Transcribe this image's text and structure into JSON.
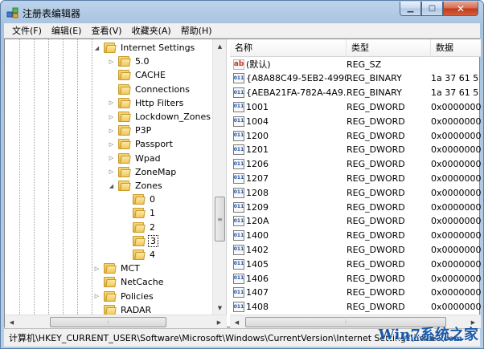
{
  "window": {
    "title": "注册表编辑器"
  },
  "menu": [
    {
      "label": "文件(F)"
    },
    {
      "label": "编辑(E)"
    },
    {
      "label": "查看(V)"
    },
    {
      "label": "收藏夹(A)"
    },
    {
      "label": "帮助(H)"
    }
  ],
  "tree": {
    "items": [
      {
        "label": "Internet Settings",
        "expander": "open",
        "level": 0
      },
      {
        "label": "5.0",
        "expander": "closed",
        "level": 1
      },
      {
        "label": "CACHE",
        "expander": "none",
        "level": 1
      },
      {
        "label": "Connections",
        "expander": "none",
        "level": 1
      },
      {
        "label": "Http Filters",
        "expander": "closed",
        "level": 1
      },
      {
        "label": "Lockdown_Zones",
        "expander": "closed",
        "level": 1
      },
      {
        "label": "P3P",
        "expander": "closed",
        "level": 1
      },
      {
        "label": "Passport",
        "expander": "closed",
        "level": 1
      },
      {
        "label": "Wpad",
        "expander": "closed",
        "level": 1
      },
      {
        "label": "ZoneMap",
        "expander": "closed",
        "level": 1
      },
      {
        "label": "Zones",
        "expander": "open",
        "level": 1
      },
      {
        "label": "0",
        "expander": "none",
        "level": 2
      },
      {
        "label": "1",
        "expander": "none",
        "level": 2
      },
      {
        "label": "2",
        "expander": "none",
        "level": 2
      },
      {
        "label": "3",
        "expander": "none",
        "level": 2,
        "selected": true
      },
      {
        "label": "4",
        "expander": "none",
        "level": 2
      },
      {
        "label": "MCT",
        "expander": "closed",
        "level": -1
      },
      {
        "label": "NetCache",
        "expander": "none",
        "level": -1
      },
      {
        "label": "Policies",
        "expander": "closed",
        "level": -1
      },
      {
        "label": "RADAR",
        "expander": "none",
        "level": -1
      }
    ]
  },
  "list": {
    "columns": {
      "name": "名称",
      "type": "类型",
      "data": "数据"
    },
    "rows": [
      {
        "icon": "string-value-icon",
        "name": "(默认)",
        "type": "REG_SZ",
        "data": ""
      },
      {
        "icon": "binary-value-icon",
        "name": "{A8A88C49-5EB2-4990...",
        "type": "REG_BINARY",
        "data": "1a 37 61 5"
      },
      {
        "icon": "binary-value-icon",
        "name": "{AEBA21FA-782A-4A9...",
        "type": "REG_BINARY",
        "data": "1a 37 61 5"
      },
      {
        "icon": "binary-value-icon",
        "name": "1001",
        "type": "REG_DWORD",
        "data": "0x0000000"
      },
      {
        "icon": "binary-value-icon",
        "name": "1004",
        "type": "REG_DWORD",
        "data": "0x0000000"
      },
      {
        "icon": "binary-value-icon",
        "name": "1200",
        "type": "REG_DWORD",
        "data": "0x0000000"
      },
      {
        "icon": "binary-value-icon",
        "name": "1201",
        "type": "REG_DWORD",
        "data": "0x0000000"
      },
      {
        "icon": "binary-value-icon",
        "name": "1206",
        "type": "REG_DWORD",
        "data": "0x0000000"
      },
      {
        "icon": "binary-value-icon",
        "name": "1207",
        "type": "REG_DWORD",
        "data": "0x0000000"
      },
      {
        "icon": "binary-value-icon",
        "name": "1208",
        "type": "REG_DWORD",
        "data": "0x0000000"
      },
      {
        "icon": "binary-value-icon",
        "name": "1209",
        "type": "REG_DWORD",
        "data": "0x0000000"
      },
      {
        "icon": "binary-value-icon",
        "name": "120A",
        "type": "REG_DWORD",
        "data": "0x0000000"
      },
      {
        "icon": "binary-value-icon",
        "name": "1400",
        "type": "REG_DWORD",
        "data": "0x0000000"
      },
      {
        "icon": "binary-value-icon",
        "name": "1402",
        "type": "REG_DWORD",
        "data": "0x0000000"
      },
      {
        "icon": "binary-value-icon",
        "name": "1405",
        "type": "REG_DWORD",
        "data": "0x0000000"
      },
      {
        "icon": "binary-value-icon",
        "name": "1406",
        "type": "REG_DWORD",
        "data": "0x0000000"
      },
      {
        "icon": "binary-value-icon",
        "name": "1407",
        "type": "REG_DWORD",
        "data": "0x0000000"
      },
      {
        "icon": "binary-value-icon",
        "name": "1408",
        "type": "REG_DWORD",
        "data": "0x0000000"
      }
    ]
  },
  "statusbar": {
    "path": "计算机\\HKEY_CURRENT_USER\\Software\\Microsoft\\Windows\\CurrentVersion\\Internet Settings\\Zones\\3"
  },
  "watermark": {
    "main": "Win7系统之家",
    "sub": "Winwin7.com"
  },
  "icons": {
    "string_glyph": "ab",
    "binary_glyph": "011"
  },
  "colors": {
    "title_bg": "#bcd3ea",
    "close_button": "#c2391a",
    "folder": "#f1c75a"
  }
}
